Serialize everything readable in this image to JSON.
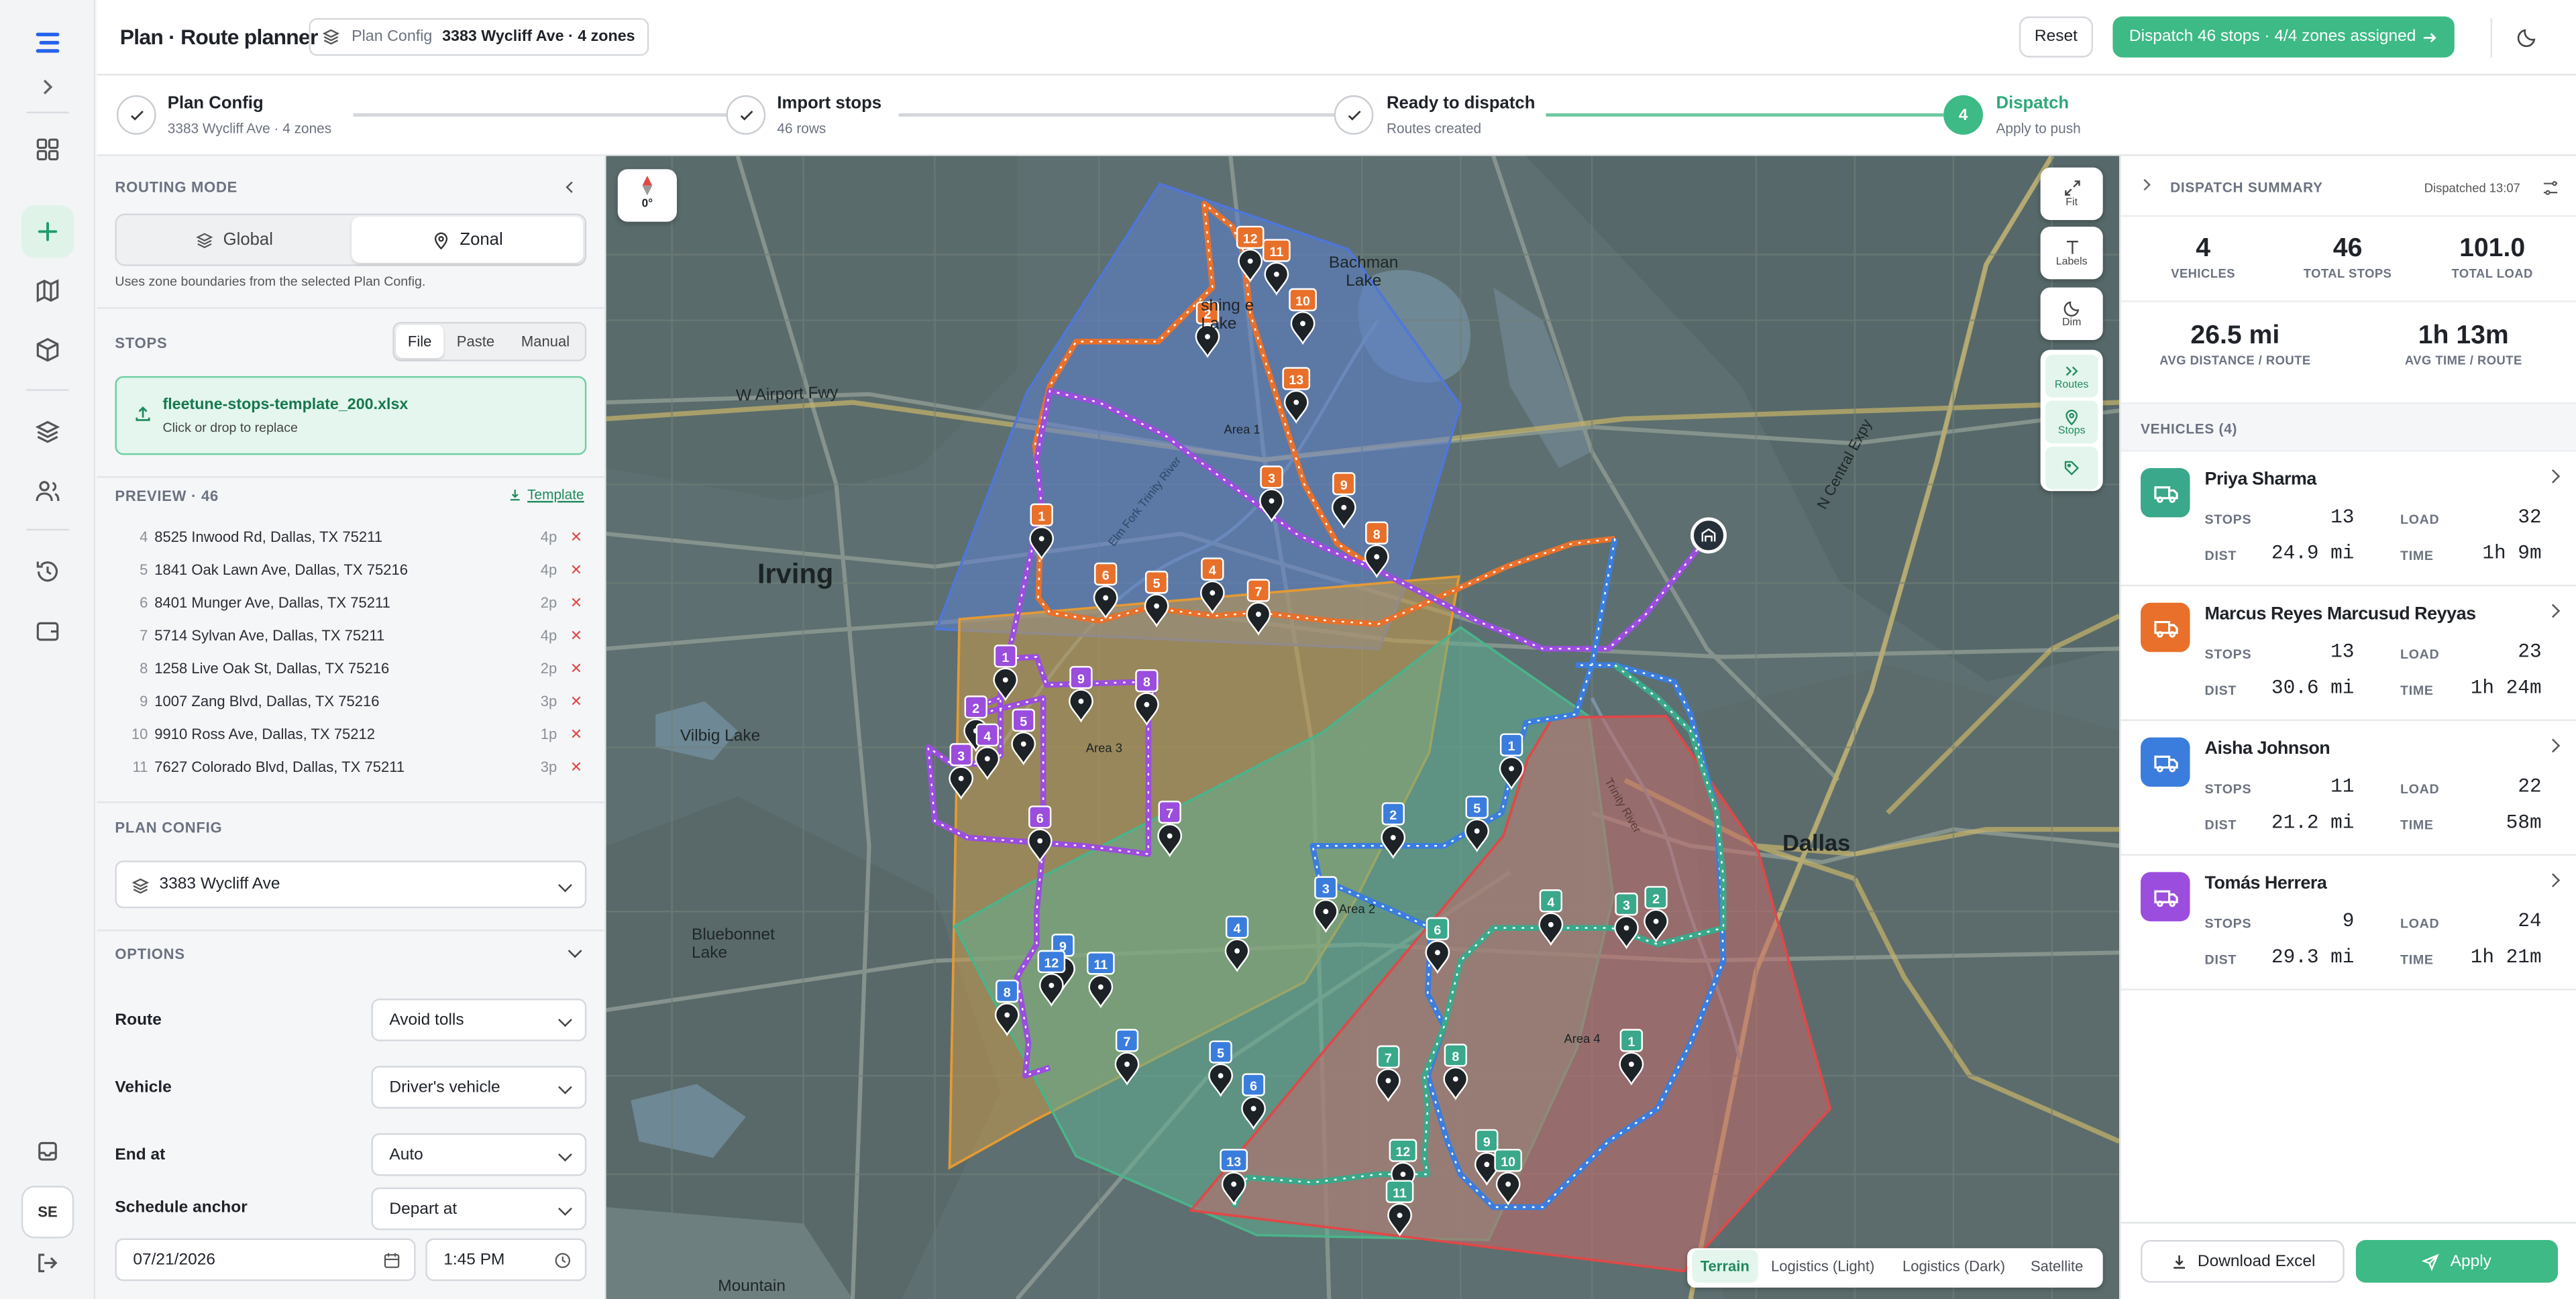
{
  "app": {
    "title": "Plan · Route planner",
    "user_initials": "SE"
  },
  "header": {
    "config_label": "Plan Config",
    "config_value": "3383 Wycliff Ave · 4 zones",
    "reset": "Reset",
    "dispatch": "Dispatch 46 stops · 4/4 zones assigned"
  },
  "steps": [
    {
      "title": "Plan Config",
      "sub": "3383 Wycliff Ave · 4 zones"
    },
    {
      "title": "Import stops",
      "sub": "46 rows"
    },
    {
      "title": "Ready to dispatch",
      "sub": "Routes created"
    },
    {
      "num": "4",
      "title": "Dispatch",
      "sub": "Apply to push"
    }
  ],
  "panel": {
    "routing_mode": "ROUTING MODE",
    "mode_global": "Global",
    "mode_zonal": "Zonal",
    "mode_hint": "Uses zone boundaries from the selected Plan Config.",
    "stops": "STOPS",
    "tab_file": "File",
    "tab_paste": "Paste",
    "tab_manual": "Manual",
    "file_name": "fleetune-stops-template_200.xlsx",
    "file_hint": "Click or drop to replace",
    "preview": "PREVIEW · 46",
    "template": "Template",
    "rows": [
      {
        "n": "4",
        "addr": "8525 Inwood Rd, Dallas, TX 75211",
        "p": "4p"
      },
      {
        "n": "5",
        "addr": "1841 Oak Lawn Ave, Dallas, TX 75216",
        "p": "4p"
      },
      {
        "n": "6",
        "addr": "8401 Munger Ave, Dallas, TX 75211",
        "p": "2p"
      },
      {
        "n": "7",
        "addr": "5714 Sylvan Ave, Dallas, TX 75211",
        "p": "4p"
      },
      {
        "n": "8",
        "addr": "1258 Live Oak St, Dallas, TX 75216",
        "p": "2p"
      },
      {
        "n": "9",
        "addr": "1007 Zang Blvd, Dallas, TX 75216",
        "p": "3p"
      },
      {
        "n": "10",
        "addr": "9910 Ross Ave, Dallas, TX 75212",
        "p": "1p"
      },
      {
        "n": "11",
        "addr": "7627 Colorado Blvd, Dallas, TX 75211",
        "p": "3p"
      }
    ],
    "plan_config": "PLAN CONFIG",
    "plan_value": "3383 Wycliff Ave",
    "options": "OPTIONS",
    "route_label": "Route",
    "route_value": "Avoid tolls",
    "vehicle_label": "Vehicle",
    "vehicle_value": "Driver's vehicle",
    "end_label": "End at",
    "end_value": "Auto",
    "anchor_label": "Schedule anchor",
    "anchor_value": "Depart at",
    "date": "07/21/2026",
    "time": "1:45 PM"
  },
  "map": {
    "compass": "0°",
    "fit": "Fit",
    "labels": "Labels",
    "dim": "Dim",
    "routes": "Routes",
    "stops": "Stops",
    "zones": [
      "Area 1",
      "Area 2",
      "Area 3",
      "Area 4"
    ],
    "basemaps": [
      "Terrain",
      "Logistics (Light)",
      "Logistics (Dark)",
      "Satellite"
    ],
    "places": {
      "irving": "Irving",
      "dallas": "Dallas",
      "vilbig": "Vilbig Lake",
      "bluebonnet": "Bluebonnet Lake",
      "mountain": "Mountain",
      "bachman": "Bachman Lake",
      "airport": "W Airport Fwy",
      "expy": "N Central Expy",
      "trinity": "Elm Fork Trinity River",
      "trinity2": "Trinity River",
      "bachman2": "shing e Lake"
    }
  },
  "summary": {
    "title": "DISPATCH SUMMARY",
    "dispatched": "Dispatched 13:07",
    "vehicles_n": "4",
    "vehicles_k": "VEHICLES",
    "stops_n": "46",
    "stops_k": "TOTAL STOPS",
    "load_n": "101.0",
    "load_k": "TOTAL LOAD",
    "dist_n": "26.5 mi",
    "dist_k": "AVG DISTANCE / ROUTE",
    "time_n": "1h 13m",
    "time_k": "AVG TIME / ROUTE",
    "veh_header": "VEHICLES (4)",
    "k_stops": "STOPS",
    "k_load": "LOAD",
    "k_dist": "DIST",
    "k_time": "TIME",
    "vehicles": [
      {
        "name": "Priya Sharma",
        "stops": "13",
        "load": "32",
        "dist": "24.9 mi",
        "time": "1h 9m",
        "color": "#3aa88a"
      },
      {
        "name": "Marcus Reyes Marcusud Reyyas",
        "stops": "13",
        "load": "23",
        "dist": "30.6 mi",
        "time": "1h 24m",
        "color": "#e8702a"
      },
      {
        "name": "Aisha Johnson",
        "stops": "11",
        "load": "22",
        "dist": "21.2 mi",
        "time": "58m",
        "color": "#3b7ddd"
      },
      {
        "name": "Tomás Herrera",
        "stops": "9",
        "load": "24",
        "dist": "29.3 mi",
        "time": "1h 21m",
        "color": "#9b4dde"
      }
    ],
    "download": "Download Excel",
    "apply": "Apply"
  }
}
